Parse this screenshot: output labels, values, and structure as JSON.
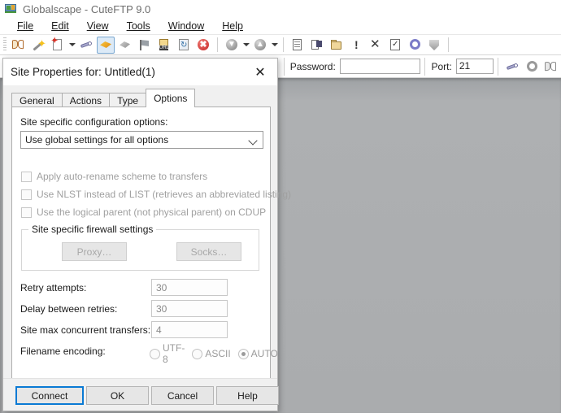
{
  "window": {
    "title": "Globalscape - CuteFTP 9.0",
    "app_icon": "globalscape-icon"
  },
  "menu": {
    "items": [
      {
        "label": "File"
      },
      {
        "label": "Edit"
      },
      {
        "label": "View"
      },
      {
        "label": "Tools"
      },
      {
        "label": "Window"
      },
      {
        "label": "Help"
      }
    ]
  },
  "toolbar": {
    "buttons": [
      {
        "name": "site-manager-icon",
        "title": "Site Manager"
      },
      {
        "name": "quick-connect-wizard-icon",
        "title": "Connection Wizard"
      },
      {
        "name": "new-site-icon",
        "title": "New Site"
      },
      {
        "name": "new-site-dropdown-arrow",
        "title": "New"
      },
      {
        "name": "connect-icon",
        "title": "Connect"
      },
      {
        "name": "disconnect-icon",
        "title": "Disconnect"
      },
      {
        "name": "reconnect-icon",
        "title": "Reconnect"
      },
      {
        "name": "stop-flag-icon",
        "title": "Stop"
      },
      {
        "name": "url-icon",
        "title": "Copy URL"
      },
      {
        "name": "refresh-icon",
        "title": "Refresh"
      },
      {
        "name": "abort-icon",
        "title": "Abort"
      },
      {
        "name": "download-icon",
        "title": "Download"
      },
      {
        "name": "download-dropdown-arrow",
        "title": "Download options"
      },
      {
        "name": "upload-icon",
        "title": "Upload"
      },
      {
        "name": "upload-dropdown-arrow",
        "title": "Upload options"
      },
      {
        "name": "edit-notes-icon",
        "title": "Edit"
      },
      {
        "name": "rename-icon",
        "title": "Rename"
      },
      {
        "name": "new-folder-icon",
        "title": "New Folder"
      },
      {
        "name": "properties-icon",
        "title": "Properties"
      },
      {
        "name": "delete-icon",
        "title": "Delete"
      },
      {
        "name": "select-all-icon",
        "title": "Select"
      },
      {
        "name": "global-options-icon",
        "title": "Global Options"
      },
      {
        "name": "security-icon",
        "title": "Security"
      }
    ]
  },
  "connection_bar": {
    "password_label": "Password:",
    "password_value": "",
    "password_placeholder": "",
    "port_label": "Port:",
    "port_value": "21",
    "buttons": [
      {
        "name": "connect-toolbar-icon"
      },
      {
        "name": "global-options-toolbar-icon"
      },
      {
        "name": "site-manager-toolbar-icon"
      }
    ]
  },
  "dialog": {
    "title": "Site Properties for: Untitled(1)",
    "close_label": "✕",
    "tabs": [
      {
        "label": "General",
        "active": false
      },
      {
        "label": "Actions",
        "active": false
      },
      {
        "label": "Type",
        "active": false
      },
      {
        "label": "Options",
        "active": true
      }
    ],
    "options": {
      "config_label": "Site specific configuration options:",
      "config_value": "Use global settings for all options",
      "checkboxes": [
        {
          "label": "Apply auto-rename scheme to transfers",
          "checked": false,
          "enabled": false
        },
        {
          "label": "Use NLST instead of LIST (retrieves an abbreviated listing)",
          "checked": false,
          "enabled": false
        },
        {
          "label": "Use the logical parent (not physical parent) on CDUP",
          "checked": false,
          "enabled": false
        }
      ],
      "firewall_group": {
        "title": "Site specific firewall settings",
        "proxy_button": "Proxy…",
        "socks_button": "Socks…"
      },
      "fields": [
        {
          "label": "Retry attempts:",
          "value": "30"
        },
        {
          "label": "Delay between retries:",
          "value": "30"
        },
        {
          "label": "Site max concurrent transfers:",
          "value": "4"
        }
      ],
      "encoding_label": "Filename encoding:",
      "encoding_options": [
        {
          "label": "UTF-8",
          "selected": false
        },
        {
          "label": "ASCII",
          "selected": false
        },
        {
          "label": "AUTO",
          "selected": true
        }
      ]
    },
    "footer_buttons": [
      {
        "label": "Connect",
        "primary": true
      },
      {
        "label": "OK",
        "primary": false
      },
      {
        "label": "Cancel",
        "primary": false
      },
      {
        "label": "Help",
        "primary": false
      }
    ]
  },
  "colors": {
    "workspace_gray": "#a9abad",
    "dialog_face": "#f0f0f0",
    "accent_blue": "#0a7ad4",
    "selected_tool": "#dceaf7",
    "disabled_text": "#a0a0a0"
  }
}
